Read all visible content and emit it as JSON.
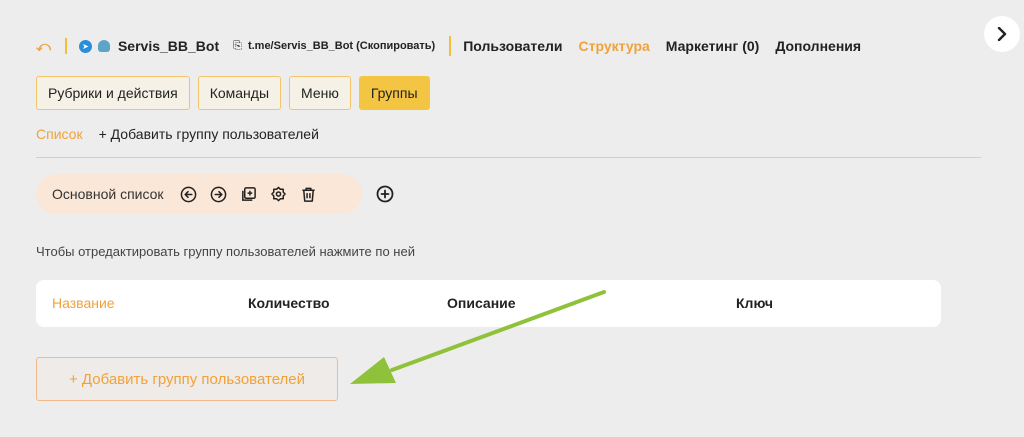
{
  "topbar": {
    "bot_name": "Servis_BB_Bot",
    "bot_link": "t.me/Servis_BB_Bot (Скопировать)",
    "nav": [
      "Пользователи",
      "Структура",
      "Маркетинг (0)",
      "Дополнения"
    ],
    "active_nav": "Структура"
  },
  "tabs": [
    "Рубрики и действия",
    "Команды",
    "Меню",
    "Группы"
  ],
  "subnav": {
    "list": "Список",
    "add": "+ Добавить группу пользователей"
  },
  "toolbar": {
    "list_label": "Основной список",
    "icons": [
      "arrow-left-circle-icon",
      "arrow-right-circle-icon",
      "copy-plus-icon",
      "settings-icon",
      "trash-icon",
      "plus-circle-icon"
    ]
  },
  "hint": "Чтобы отредактировать группу пользователей нажмите по ней",
  "table": {
    "headers": [
      "Название",
      "Количество",
      "Описание",
      "Ключ"
    ]
  },
  "add_group_button": "+ Добавить группу пользователей",
  "colors": {
    "accent": "#f0a23a",
    "active_tab": "#f3c543",
    "arrow": "#8fc23a"
  }
}
